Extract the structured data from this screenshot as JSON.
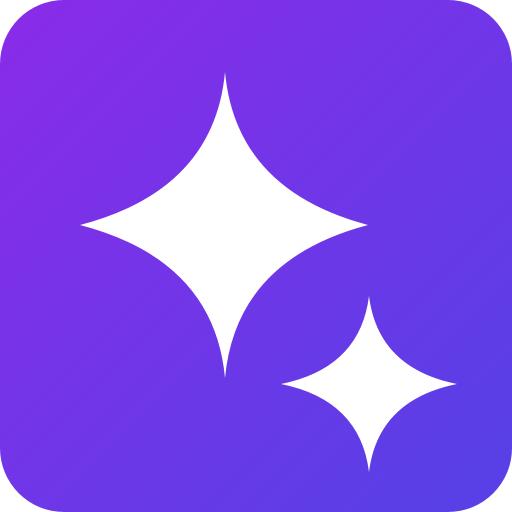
{
  "icon": {
    "name": "sparkles-app-icon",
    "glyph": "sparkles-icon",
    "colors": {
      "gradient_start": "#8a2be8",
      "gradient_end": "#5541e6",
      "sparkle": "#ffffff",
      "page_background": "#ffffff"
    }
  }
}
